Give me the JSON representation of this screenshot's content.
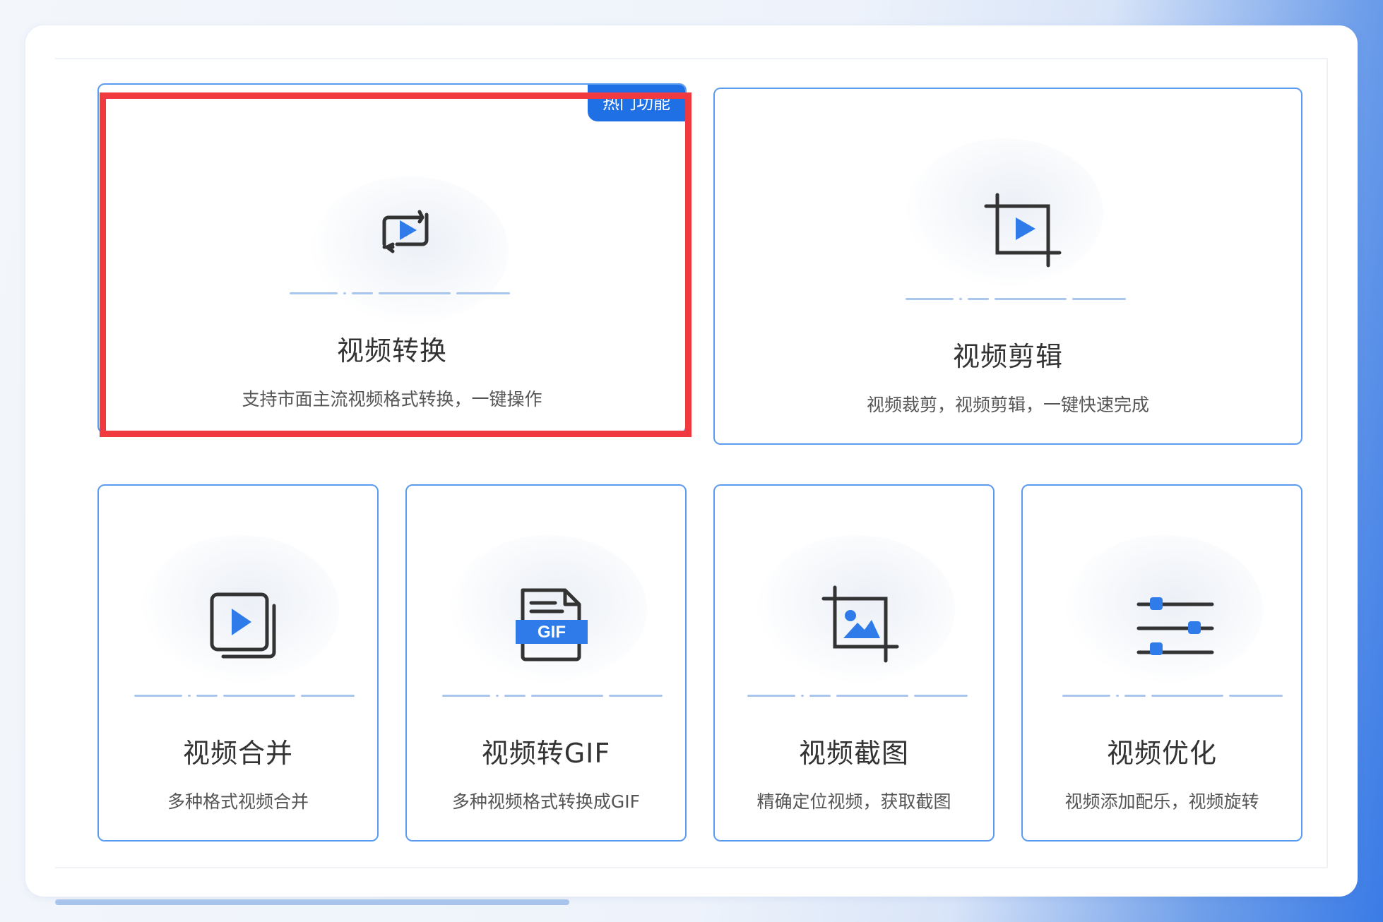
{
  "cards": [
    {
      "title": "视频转换",
      "desc": "支持市面主流视频格式转换，一键操作",
      "badge": "热门功能",
      "icon": "video-convert-icon"
    },
    {
      "title": "视频剪辑",
      "desc": "视频裁剪，视频剪辑，一键快速完成",
      "icon": "video-crop-icon"
    },
    {
      "title": "视频合并",
      "desc": "多种格式视频合并",
      "icon": "video-merge-icon"
    },
    {
      "title": "视频转GIF",
      "desc": "多种视频格式转换成GIF",
      "icon": "gif-file-icon",
      "icon_text": "GIF"
    },
    {
      "title": "视频截图",
      "desc": "精确定位视频，获取截图",
      "icon": "screenshot-crop-icon"
    },
    {
      "title": "视频优化",
      "desc": "视频添加配乐，视频旋转",
      "icon": "sliders-icon"
    }
  ],
  "colors": {
    "accent": "#1f6fe5",
    "icon_blue": "#2f7bea",
    "card_border": "#5b9cf0",
    "highlight": "#f03a3f",
    "text_title": "#333333",
    "text_desc": "#555555"
  }
}
